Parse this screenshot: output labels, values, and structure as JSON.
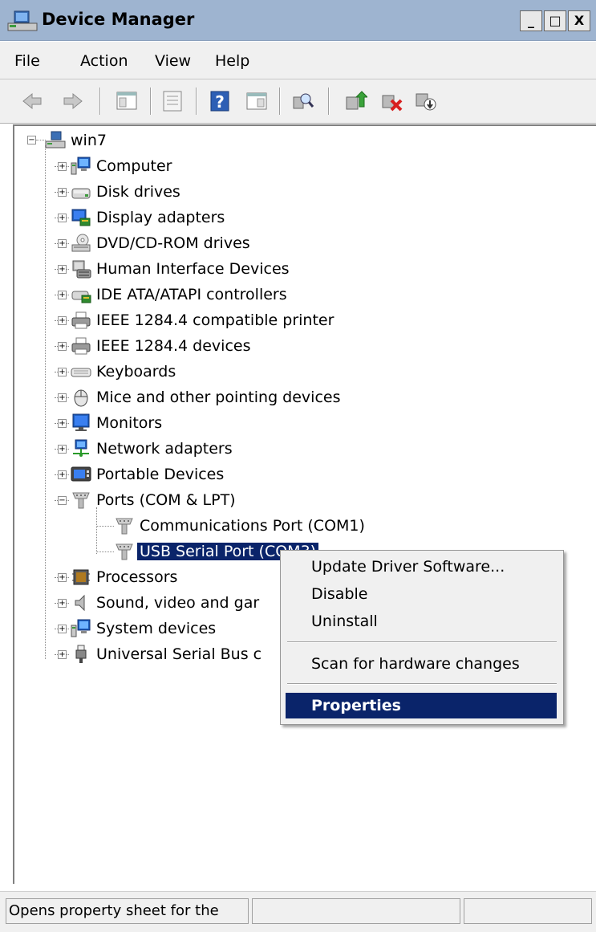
{
  "window": {
    "title": "Device Manager",
    "minimize": "_",
    "maximize": "□",
    "close": "X"
  },
  "menu": [
    "File",
    "Action",
    "View",
    "Help"
  ],
  "toolbar": [
    "back-icon",
    "forward-icon",
    "show-hide-tree-icon",
    "properties-icon",
    "help-icon",
    "action-pane-icon",
    "scan-hardware-icon",
    "update-driver-icon",
    "uninstall-icon",
    "disable-icon"
  ],
  "tree": {
    "root": "win7",
    "items": [
      {
        "label": "Computer",
        "icon": "computer-icon"
      },
      {
        "label": "Disk drives",
        "icon": "disk-drive-icon"
      },
      {
        "label": "Display adapters",
        "icon": "display-adapter-icon"
      },
      {
        "label": "DVD/CD-ROM drives",
        "icon": "dvd-drive-icon"
      },
      {
        "label": "Human Interface Devices",
        "icon": "hid-icon"
      },
      {
        "label": "IDE ATA/ATAPI controllers",
        "icon": "ide-controller-icon"
      },
      {
        "label": "IEEE 1284.4 compatible printer",
        "icon": "printer-icon"
      },
      {
        "label": "IEEE 1284.4 devices",
        "icon": "printer-icon"
      },
      {
        "label": "Keyboards",
        "icon": "keyboard-icon"
      },
      {
        "label": "Mice and other pointing devices",
        "icon": "mouse-icon"
      },
      {
        "label": "Monitors",
        "icon": "monitor-icon"
      },
      {
        "label": "Network adapters",
        "icon": "network-adapter-icon"
      },
      {
        "label": "Portable Devices",
        "icon": "portable-device-icon"
      },
      {
        "label": "Ports (COM & LPT)",
        "icon": "port-icon"
      },
      {
        "label": "Communications Port (COM1)",
        "icon": "port-icon"
      },
      {
        "label": "USB Serial Port (COM3)",
        "icon": "port-icon"
      },
      {
        "label": "Processors",
        "icon": "processor-icon"
      },
      {
        "label": "Sound, video and gar",
        "icon": "speaker-icon"
      },
      {
        "label": "System devices",
        "icon": "computer-icon"
      },
      {
        "label": "Universal Serial Bus c",
        "icon": "usb-icon"
      }
    ]
  },
  "context_menu": {
    "update": "Update Driver Software...",
    "disable": "Disable",
    "uninstall": "Uninstall",
    "scan": "Scan for hardware changes",
    "properties": "Properties"
  },
  "status": {
    "text": "Opens property sheet for the"
  },
  "colors": {
    "selection": "#0a246a",
    "titlebar": "#9eb4d0",
    "chrome": "#f0f0f0"
  }
}
